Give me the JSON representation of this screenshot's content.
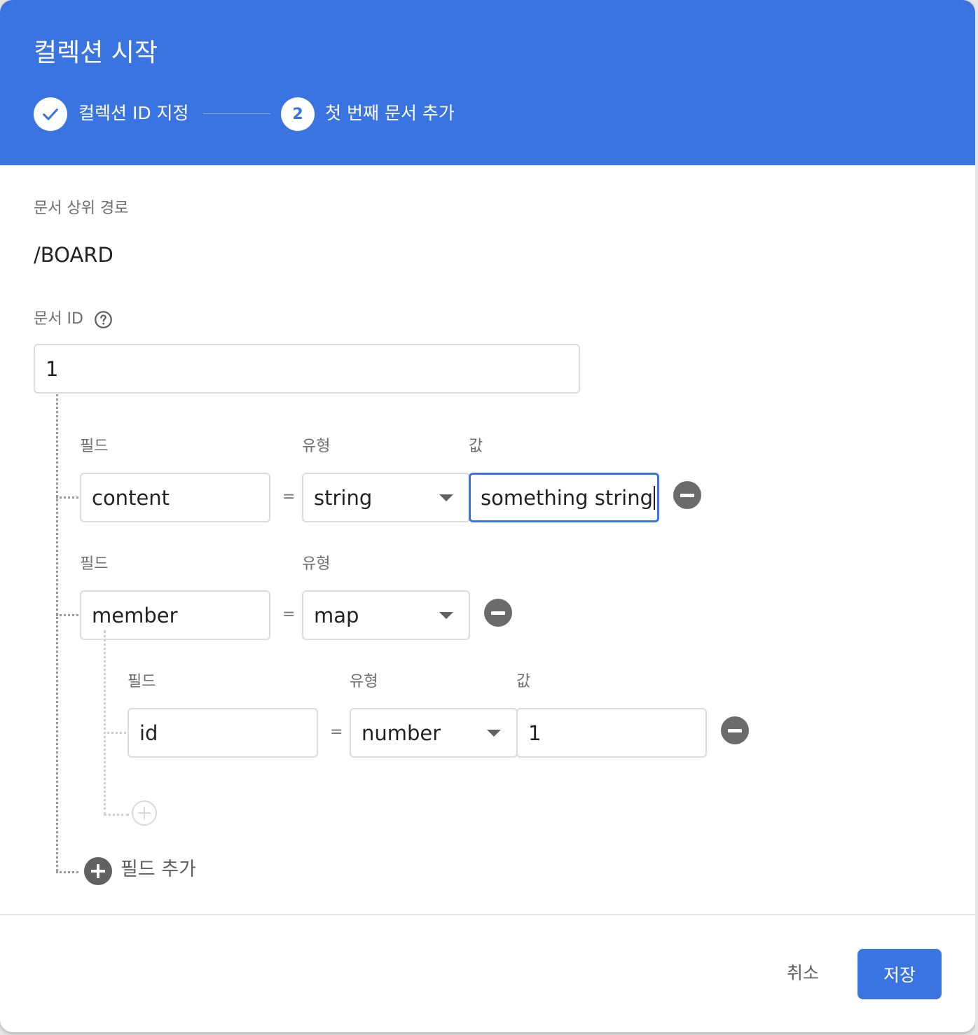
{
  "dialog": {
    "title": "컬렉션 시작",
    "steps": [
      {
        "label": "컬렉션 ID 지정",
        "state": "done"
      },
      {
        "number": "2",
        "label": "첫 번째 문서 추가",
        "state": "active"
      }
    ]
  },
  "parent_path": {
    "label": "문서 상위 경로",
    "value": "/BOARD"
  },
  "document_id": {
    "label": "문서 ID",
    "value": "1"
  },
  "fields": [
    {
      "field_label": "필드",
      "type_label": "유형",
      "value_label": "값",
      "name": "content",
      "equals": "=",
      "type": "string",
      "value": "something string"
    },
    {
      "field_label": "필드",
      "type_label": "유형",
      "name": "member",
      "equals": "=",
      "type": "map",
      "children": [
        {
          "field_label": "필드",
          "type_label": "유형",
          "value_label": "값",
          "name": "id",
          "equals": "=",
          "type": "number",
          "value": "1"
        }
      ]
    }
  ],
  "add_field_label": "필드 추가",
  "footer": {
    "cancel_label": "취소",
    "save_label": "저장"
  },
  "colors": {
    "accent": "#3a74e0",
    "header_bg": "#3a74e0",
    "icon_gray": "#616161"
  }
}
